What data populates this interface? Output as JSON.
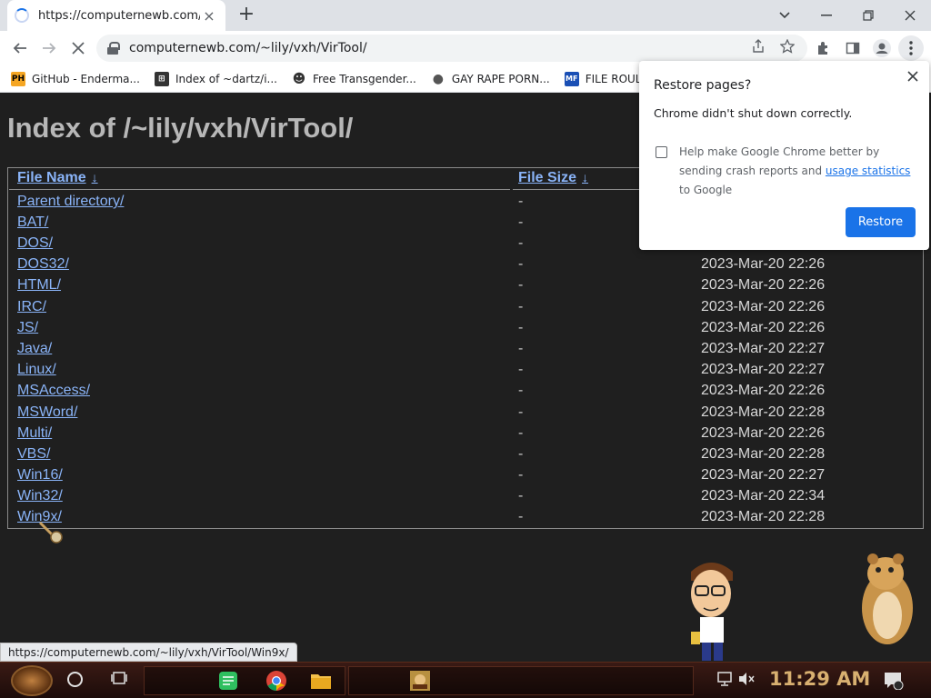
{
  "browser": {
    "tab_title": "https://computernewb.com/~lil",
    "tab_close_icon": "×",
    "new_tab_icon": "+",
    "url": "computernewb.com/~lily/vxh/VirTool/",
    "bookmarks": [
      {
        "label": "GitHub - Enderma...",
        "icon": "PH",
        "color": "#f5a623"
      },
      {
        "label": "Index of ~dartz/i...",
        "icon": "⊞",
        "color": "#333333"
      },
      {
        "label": "Free Transgender...",
        "icon": "☻",
        "color": "#333333"
      },
      {
        "label": "GAY RAPE PORN...",
        "icon": "●",
        "color": "#555555"
      },
      {
        "label": "FILE ROULETTE",
        "icon": "MF",
        "color": "#1a4fb5"
      }
    ]
  },
  "page": {
    "heading": "Index of /~lily/vxh/VirTool/",
    "columns": {
      "name": "File Name",
      "size": "File Size",
      "arrow": "↓"
    },
    "rows": [
      {
        "name": "Parent directory/",
        "size": "-",
        "date": ""
      },
      {
        "name": "BAT/",
        "size": "-",
        "date": ""
      },
      {
        "name": "DOS/",
        "size": "-",
        "date": ""
      },
      {
        "name": "DOS32/",
        "size": "-",
        "date": "2023-Mar-20 22:26"
      },
      {
        "name": "HTML/",
        "size": "-",
        "date": "2023-Mar-20 22:26"
      },
      {
        "name": "IRC/",
        "size": "-",
        "date": "2023-Mar-20 22:26"
      },
      {
        "name": "JS/",
        "size": "-",
        "date": "2023-Mar-20 22:26"
      },
      {
        "name": "Java/",
        "size": "-",
        "date": "2023-Mar-20 22:27"
      },
      {
        "name": "Linux/",
        "size": "-",
        "date": "2023-Mar-20 22:27"
      },
      {
        "name": "MSAccess/",
        "size": "-",
        "date": "2023-Mar-20 22:26"
      },
      {
        "name": "MSWord/",
        "size": "-",
        "date": "2023-Mar-20 22:28"
      },
      {
        "name": "Multi/",
        "size": "-",
        "date": "2023-Mar-20 22:26"
      },
      {
        "name": "VBS/",
        "size": "-",
        "date": "2023-Mar-20 22:28"
      },
      {
        "name": "Win16/",
        "size": "-",
        "date": "2023-Mar-20 22:27"
      },
      {
        "name": "Win32/",
        "size": "-",
        "date": "2023-Mar-20 22:34"
      },
      {
        "name": "Win9x/",
        "size": "-",
        "date": "2023-Mar-20 22:28"
      }
    ],
    "status_url": "https://computernewb.com/~lily/vxh/VirTool/Win9x/"
  },
  "popup": {
    "title": "Restore pages?",
    "message": "Chrome didn't shut down correctly.",
    "help_text": "Help make Google Chrome better by sending crash reports and",
    "help_link": "usage statistics",
    "help_tail": "to Google",
    "restore_label": "Restore"
  },
  "taskbar": {
    "clock": "11:29 AM"
  }
}
